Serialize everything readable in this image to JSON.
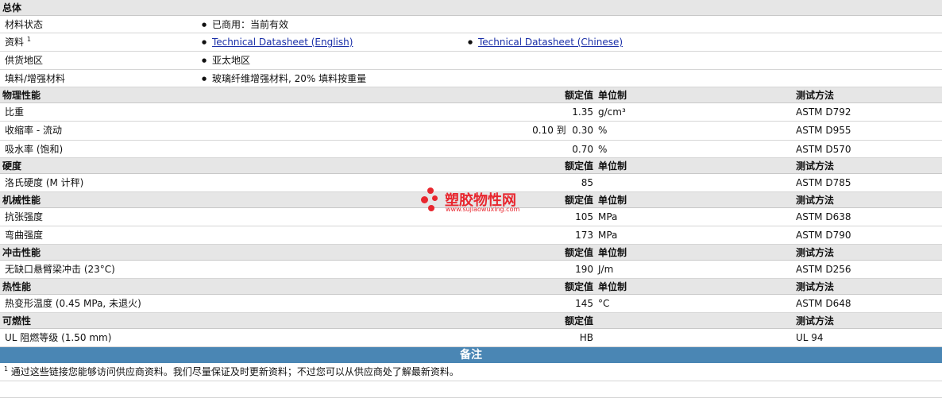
{
  "overall": {
    "title": "总体",
    "rows": [
      {
        "label": "材料状态",
        "value": "已商用：当前有效"
      },
      {
        "label": "资料",
        "sup": "1",
        "link1": "Technical Datasheet (English)",
        "link2": "Technical Datasheet (Chinese)"
      },
      {
        "label": "供货地区",
        "value": "亚太地区"
      },
      {
        "label": "填料/增强材料",
        "value": "玻璃纤维增强材料, 20% 填料按重量"
      }
    ]
  },
  "columns": {
    "rated": "额定值",
    "unit": "单位制",
    "test": "测试方法"
  },
  "sections": [
    {
      "title": "物理性能",
      "rows": [
        {
          "label": "比重",
          "value": "1.35",
          "unit": "g/cm³",
          "test": "ASTM D792"
        },
        {
          "label": "收缩率 - 流动",
          "value": "0.10 到  0.30",
          "unit": "%",
          "test": "ASTM D955"
        },
        {
          "label": "吸水率 (饱和)",
          "value": "0.70",
          "unit": "%",
          "test": "ASTM D570"
        }
      ]
    },
    {
      "title": "硬度",
      "rows": [
        {
          "label": "洛氏硬度 (M 计秤)",
          "value": "85",
          "unit": "",
          "test": "ASTM D785"
        }
      ]
    },
    {
      "title": "机械性能",
      "rows": [
        {
          "label": "抗张强度",
          "value": "105",
          "unit": "MPa",
          "test": "ASTM D638"
        },
        {
          "label": "弯曲强度",
          "value": "173",
          "unit": "MPa",
          "test": "ASTM D790"
        }
      ]
    },
    {
      "title": "冲击性能",
      "rows": [
        {
          "label": "无缺口悬臂梁冲击 (23°C)",
          "value": "190",
          "unit": "J/m",
          "test": "ASTM D256"
        }
      ]
    },
    {
      "title": "热性能",
      "rows": [
        {
          "label": "热变形温度 (0.45 MPa, 未退火)",
          "value": "145",
          "unit": "°C",
          "test": "ASTM D648"
        }
      ]
    },
    {
      "title": "可燃性",
      "rows": [
        {
          "label": "UL 阻燃等级 (1.50 mm)",
          "value": "HB",
          "unit": "",
          "test": "UL 94"
        }
      ]
    }
  ],
  "notes": {
    "title": "备注",
    "sup": "1",
    "text": "通过这些链接您能够访问供应商资料。我们尽量保证及时更新资料；不过您可以从供应商处了解最新资料。"
  },
  "watermark": {
    "name": "塑胶物性网",
    "url": "www.sujiaowuxing.com"
  },
  "colors": {
    "header_bg": "#e6e6e6",
    "notes_bar": "#4a86b4",
    "link": "#1a2fa8",
    "watermark": "#e8262e"
  }
}
